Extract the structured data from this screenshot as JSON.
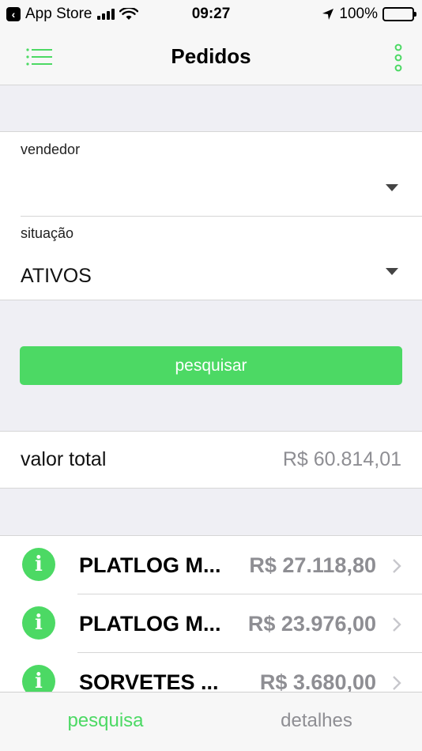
{
  "status_bar": {
    "back_app": "App Store",
    "time": "09:27",
    "battery": "100%"
  },
  "nav": {
    "title": "Pedidos",
    "menu_icon": "list-menu-icon",
    "more_icon": "vertical-dots-icon"
  },
  "form": {
    "vendedor": {
      "label": "vendedor",
      "value": ""
    },
    "situacao": {
      "label": "situação",
      "value": "ATIVOS"
    }
  },
  "search_button": {
    "label": "pesquisar"
  },
  "total": {
    "label": "valor total",
    "value": "R$ 60.814,01"
  },
  "orders": [
    {
      "name": "PLATLOG M...",
      "value": "R$ 27.118,80"
    },
    {
      "name": "PLATLOG M...",
      "value": "R$ 23.976,00"
    },
    {
      "name": "SORVETES ...",
      "value": "R$ 3.680,00"
    }
  ],
  "tabs": [
    {
      "label": "pesquisa",
      "active": true
    },
    {
      "label": "detalhes",
      "active": false
    }
  ],
  "colors": {
    "accent": "#4cd964",
    "muted": "#8e8e93",
    "background": "#efeff4"
  }
}
